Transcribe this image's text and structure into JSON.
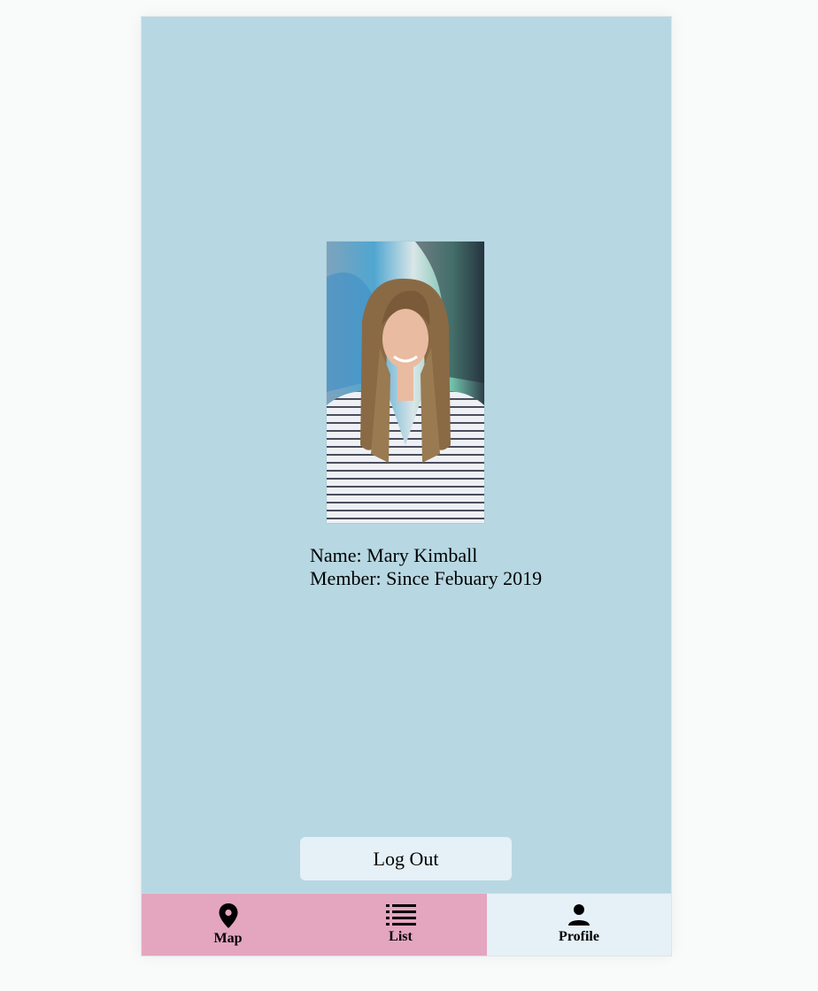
{
  "profile": {
    "name_line": "Name: Mary Kimball",
    "member_line": "Member: Since Febuary 2019"
  },
  "logout_label": "Log Out",
  "tabs": [
    {
      "label": "Map",
      "icon": "map-pin-icon",
      "active": false
    },
    {
      "label": "List",
      "icon": "list-icon",
      "active": false
    },
    {
      "label": "Profile",
      "icon": "person-icon",
      "active": true
    }
  ],
  "colors": {
    "screen_bg": "#b7d8e3",
    "tab_inactive": "#e4a6bf",
    "tab_active": "#e5f1f7",
    "button_bg": "#e5f1f7"
  }
}
